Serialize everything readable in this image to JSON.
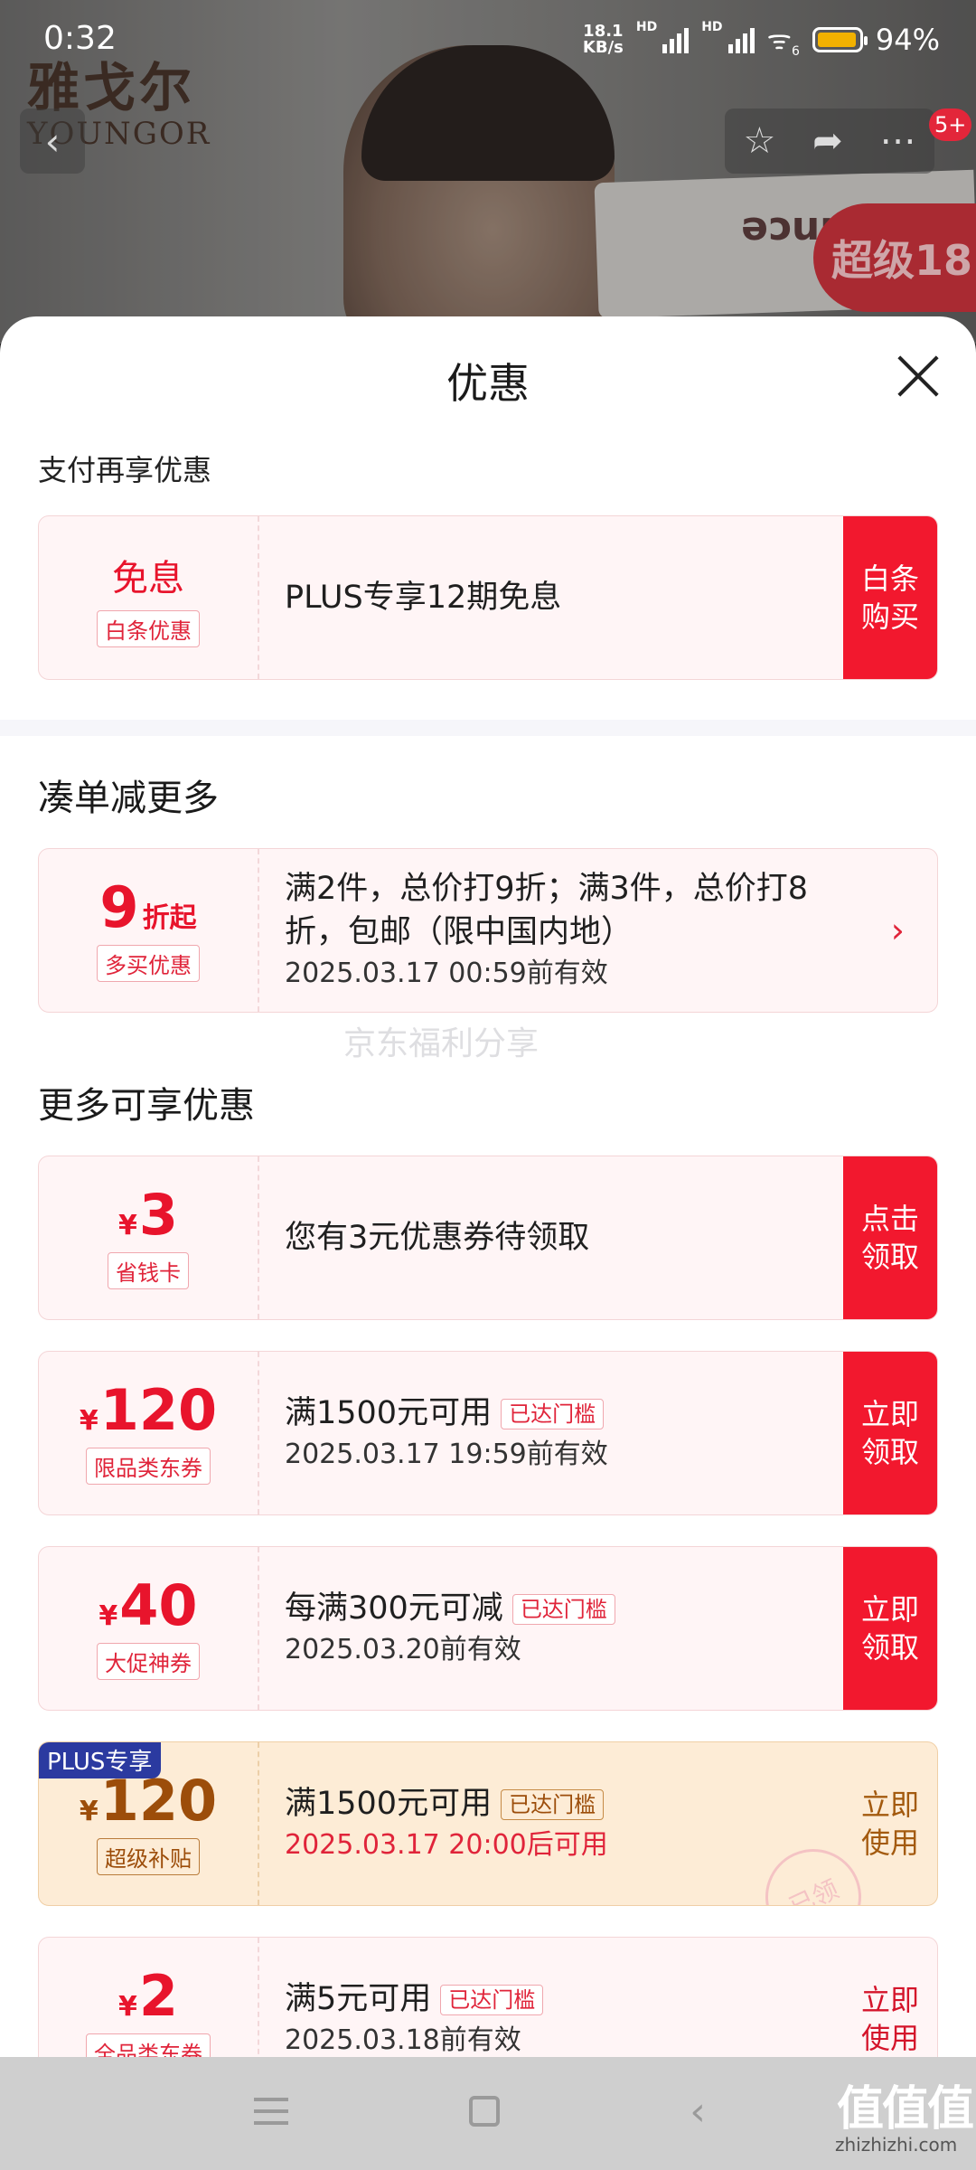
{
  "status_bar": {
    "time": "0:32",
    "net_speed_value": "18.1",
    "net_speed_unit": "KB/s",
    "hd1": "HD",
    "hd2": "HD",
    "wifi_label": "6",
    "battery": "94%"
  },
  "background": {
    "brand_cn": "雅戈尔",
    "brand_en": "YOUNGOR",
    "badge_text": "超级18",
    "box_text": "ance",
    "message_count": "5+"
  },
  "sheet": {
    "title": "优惠",
    "pay_section_label": "支付再享优惠",
    "pay_card": {
      "left_title": "免息",
      "left_tag": "白条优惠",
      "text": "PLUS专享12期免息",
      "action_line1": "白条",
      "action_line2": "购买"
    },
    "bundle_section_title": "凑单减更多",
    "bundle_card": {
      "num": "9",
      "suffix": "折起",
      "tag": "多买优惠",
      "line1": "满2件，总价打9折；满3件，总价打8",
      "line2": "折，包邮（限中国内地）",
      "line3": "2025.03.17 00:59前有效"
    },
    "watermark": "京东福利分享",
    "more_section_title": "更多可享优惠",
    "coupons": [
      {
        "yen": "¥",
        "amount": "3",
        "tag": "省钱卡",
        "line1": "您有3元优惠券待领取",
        "line2": "",
        "pill": "",
        "action1": "点击",
        "action2": "领取"
      },
      {
        "yen": "¥",
        "amount": "120",
        "tag": "限品类东券",
        "line1": "满1500元可用",
        "pill": "已达门槛",
        "line2": "2025.03.17 19:59前有效",
        "action1": "立即",
        "action2": "领取"
      },
      {
        "yen": "¥",
        "amount": "40",
        "tag": "大促神券",
        "line1": "每满300元可减",
        "pill": "已达门槛",
        "line2": "2025.03.20前有效",
        "action1": "立即",
        "action2": "领取"
      },
      {
        "badge": "PLUS专享",
        "yen": "¥",
        "amount": "120",
        "tag": "超级补贴",
        "line1": "满1500元可用",
        "pill": "已达门槛",
        "line2": "2025.03.17 20:00后可用",
        "action1": "立即",
        "action2": "使用",
        "stamp": "已领"
      },
      {
        "yen": "¥",
        "amount": "2",
        "tag": "全品类东券",
        "line1": "满5元可用",
        "pill": "已达门槛",
        "line2": "2025.03.18前有效",
        "action1": "立即",
        "action2": "使用"
      }
    ]
  },
  "footer": {
    "logo_text": "值值值",
    "site": "zhizhizhi.com"
  },
  "icons": {
    "back": "chevron-left-icon",
    "favorite": "star-icon",
    "share": "share-icon",
    "more": "more-dots-icon",
    "close": "close-icon",
    "arrow": "chevron-right-icon"
  }
}
